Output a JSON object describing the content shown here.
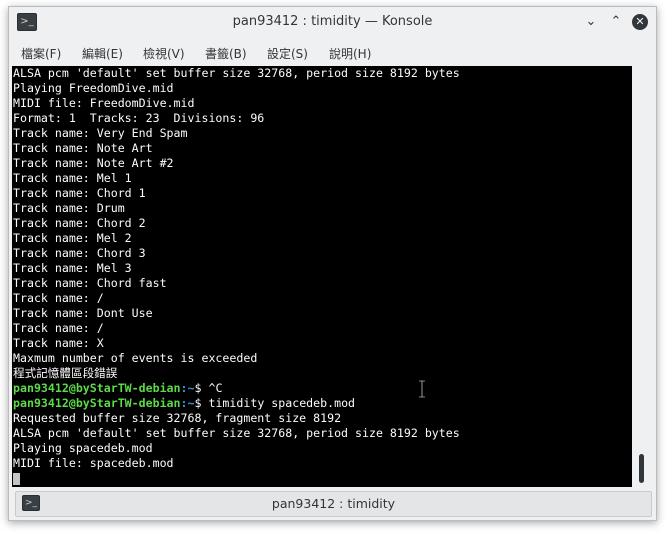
{
  "window": {
    "title": "pan93412 : timidity — Konsole",
    "minimize_glyph": "⌄",
    "maximize_glyph": "⌃",
    "close_glyph": "✕"
  },
  "menu": {
    "items": [
      {
        "label": "檔案(F)"
      },
      {
        "label": "編輯(E)"
      },
      {
        "label": "檢視(V)"
      },
      {
        "label": "書籤(B)"
      },
      {
        "label": "設定(S)"
      },
      {
        "label": "說明(H)"
      }
    ]
  },
  "terminal": {
    "lines": [
      {
        "text": "ALSA pcm 'default' set buffer size 32768, period size 8192 bytes"
      },
      {
        "text": "Playing FreedomDive.mid"
      },
      {
        "text": "MIDI file: FreedomDive.mid"
      },
      {
        "text": "Format: 1  Tracks: 23  Divisions: 96"
      },
      {
        "text": "Track name: Very End Spam"
      },
      {
        "text": "Track name: Note Art"
      },
      {
        "text": "Track name: Note Art #2"
      },
      {
        "text": "Track name: Mel 1"
      },
      {
        "text": "Track name: Chord 1"
      },
      {
        "text": "Track name: Drum"
      },
      {
        "text": "Track name: Chord 2"
      },
      {
        "text": "Track name: Mel 2"
      },
      {
        "text": "Track name: Chord 3"
      },
      {
        "text": "Track name: Mel 3"
      },
      {
        "text": "Track name: Chord fast"
      },
      {
        "text": "Track name: /"
      },
      {
        "text": "Track name: Dont Use"
      },
      {
        "text": "Track name: /"
      },
      {
        "text": "Track name: X"
      },
      {
        "text": "Maxmum number of events is exceeded"
      },
      {
        "text": "程式記憶體區段錯誤"
      },
      {
        "user": "pan93412@byStarTW-debian",
        "path": ":~",
        "cmd": "$ ^C"
      },
      {
        "user": "pan93412@byStarTW-debian",
        "path": ":~",
        "cmd": "$ timidity spacedeb.mod"
      },
      {
        "text": "Requested buffer size 32768, fragment size 8192"
      },
      {
        "text": "ALSA pcm 'default' set buffer size 32768, period size 8192 bytes"
      },
      {
        "text": "Playing spacedeb.mod"
      },
      {
        "text": "MIDI file: spacedeb.mod"
      }
    ],
    "scroll_position": 0.95
  },
  "tab": {
    "label": "pan93412 : timidity"
  },
  "colors": {
    "terminal_bg": "#000000",
    "terminal_fg": "#fcfcfc",
    "prompt_user": "#5ed94a",
    "prompt_path": "#3b8fd9",
    "chrome": "#eff0f1"
  },
  "icons": {
    "window_icon": "terminal-icon",
    "tab_icon": "terminal-icon"
  }
}
